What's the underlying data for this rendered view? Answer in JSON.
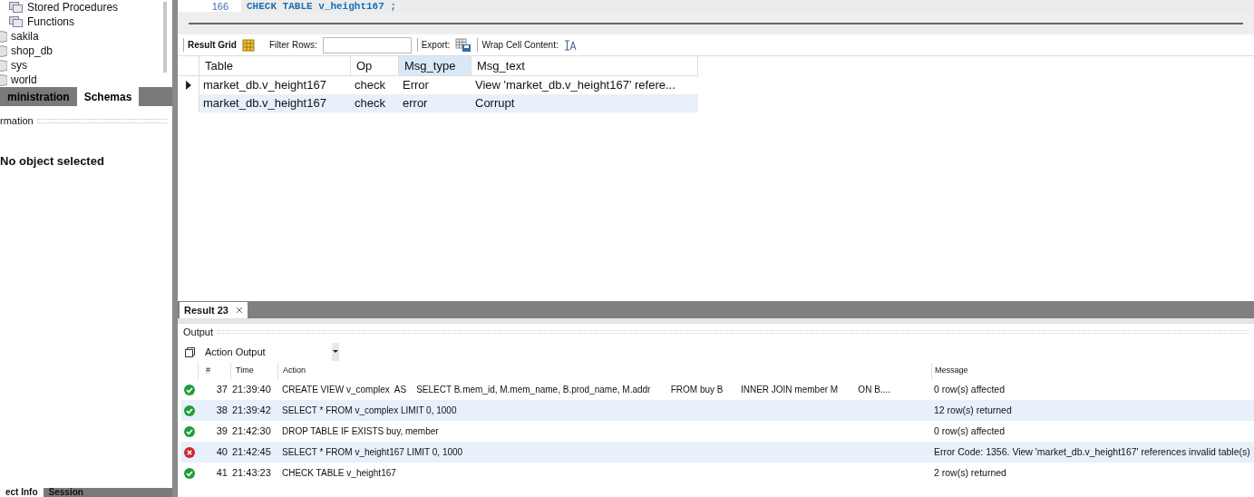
{
  "sidebar": {
    "tree": [
      {
        "label": "Stored Procedures",
        "kind": "folder"
      },
      {
        "label": "Functions",
        "kind": "folder"
      },
      {
        "label": "sakila",
        "kind": "schema"
      },
      {
        "label": "shop_db",
        "kind": "schema"
      },
      {
        "label": "sys",
        "kind": "schema"
      },
      {
        "label": "world",
        "kind": "schema"
      }
    ],
    "tabs": [
      {
        "label": "ministration",
        "selected": false
      },
      {
        "label": "Schemas",
        "selected": true
      }
    ],
    "info_header": "rmation",
    "info_text": "No object selected",
    "bottom_tabs": [
      {
        "label": "ect Info",
        "selected": true
      },
      {
        "label": "Session",
        "selected": false
      }
    ]
  },
  "editor": {
    "line_number": "166",
    "code": "CHECK TABLE v_height167 ;"
  },
  "toolbar": {
    "result_grid": "Result Grid",
    "filter_label": "Filter Rows:",
    "export_label": "Export:",
    "wrap_label": "Wrap Cell Content:"
  },
  "grid": {
    "columns": [
      {
        "label": "Table",
        "selected": false
      },
      {
        "label": "Op",
        "selected": false
      },
      {
        "label": "Msg_type",
        "selected": true
      },
      {
        "label": "Msg_text",
        "selected": false
      }
    ],
    "rows": [
      {
        "current": true,
        "cells": [
          "market_db.v_height167",
          "check",
          "Error",
          "View 'market_db.v_height167' refere..."
        ]
      },
      {
        "current": false,
        "cells": [
          "market_db.v_height167",
          "check",
          "error",
          "Corrupt"
        ]
      }
    ]
  },
  "result_tabs": [
    {
      "label": "Result 23",
      "selected": true
    }
  ],
  "output": {
    "title": "Output",
    "selector": "Action Output",
    "columns": [
      "#",
      "Time",
      "Action",
      "Message"
    ],
    "rows": [
      {
        "kind": "ok",
        "num": "37",
        "time": "21:39:40",
        "action": "CREATE VIEW v_complex  AS    SELECT B.mem_id, M.mem_name, B.prod_name, M.addr        FROM buy B       INNER JOIN member M        ON B....",
        "message": "0 row(s) affected"
      },
      {
        "kind": "ok",
        "num": "38",
        "time": "21:39:42",
        "action": "SELECT * FROM v_complex LIMIT 0, 1000",
        "message": "12 row(s) returned"
      },
      {
        "kind": "ok",
        "num": "39",
        "time": "21:42:30",
        "action": "DROP TABLE IF EXISTS buy, member",
        "message": "0 row(s) affected"
      },
      {
        "kind": "error",
        "num": "40",
        "time": "21:42:45",
        "action": "SELECT * FROM v_height167 LIMIT 0, 1000",
        "message": "Error Code: 1356. View 'market_db.v_height167' references invalid table(s)"
      },
      {
        "kind": "ok",
        "num": "41",
        "time": "21:43:23",
        "action": "CHECK TABLE v_height167",
        "message": "2 row(s) returned"
      }
    ]
  }
}
